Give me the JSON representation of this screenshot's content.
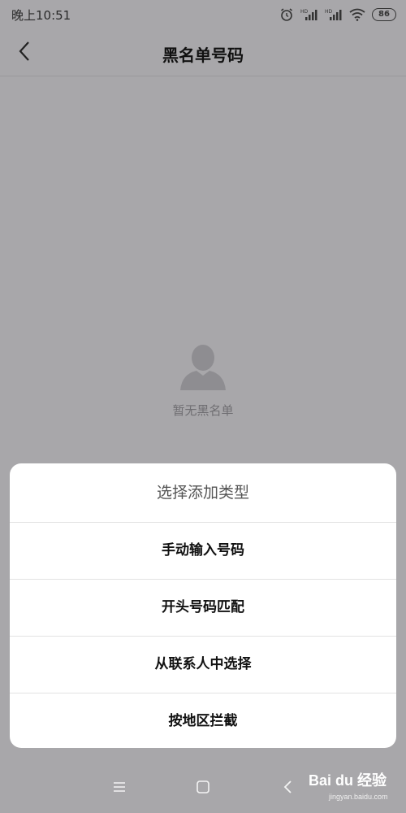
{
  "status_bar": {
    "time": "晚上10:51",
    "battery": "86",
    "icons": [
      "alarm-icon",
      "signal-hd-icon",
      "signal-hd-icon",
      "wifi-icon",
      "battery-icon"
    ]
  },
  "header": {
    "title": "黑名单号码",
    "back_icon": "back-arrow-icon"
  },
  "empty_state": {
    "icon": "person-icon",
    "message": "暂无黑名单"
  },
  "sheet": {
    "title": "选择添加类型",
    "options": [
      {
        "label": "手动输入号码"
      },
      {
        "label": "开头号码匹配"
      },
      {
        "label": "从联系人中选择"
      },
      {
        "label": "按地区拦截"
      }
    ]
  },
  "nav_bar": {
    "icons": [
      "menu-icon",
      "home-icon",
      "back-icon"
    ]
  },
  "watermark": {
    "brand": "Bai du 经验",
    "url": "jingyan.baidu.com"
  },
  "colors": {
    "background_dimmed": "#a8a7aa",
    "sheet_bg": "#ffffff"
  }
}
